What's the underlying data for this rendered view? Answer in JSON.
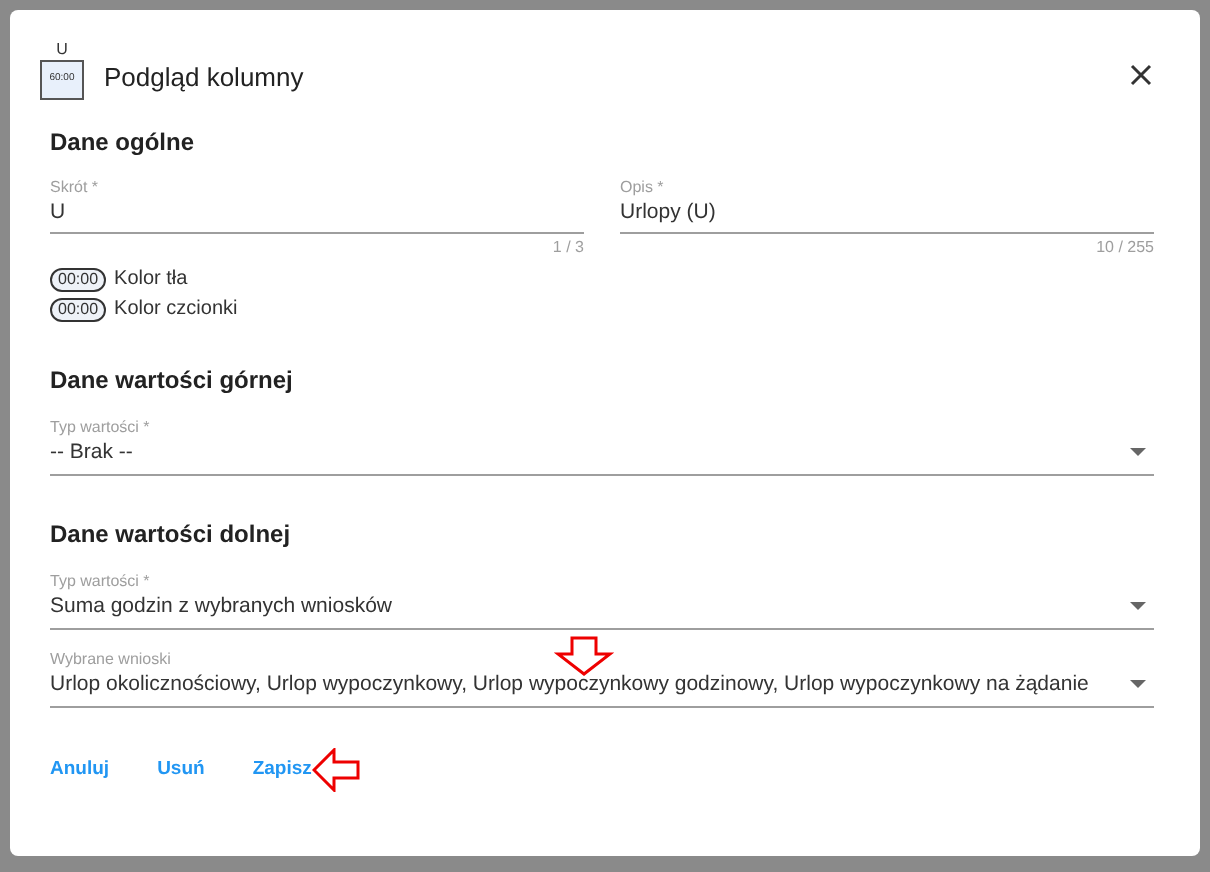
{
  "dialog": {
    "icon": {
      "letter": "U",
      "time": "60:00"
    },
    "title": "Podgląd kolumny"
  },
  "general": {
    "heading": "Dane ogólne",
    "fields": [
      {
        "label": "Skrót *",
        "value": "U",
        "counter": "1 / 3"
      },
      {
        "label": "Opis *",
        "value": "Urlopy (U)",
        "counter": "10 / 255"
      }
    ],
    "colors": [
      {
        "chip": "00:00",
        "label": "Kolor tła"
      },
      {
        "chip": "00:00",
        "label": "Kolor czcionki"
      }
    ]
  },
  "upper": {
    "heading": "Dane wartości górnej",
    "selects": [
      {
        "label": "Typ wartości *",
        "value": "-- Brak --",
        "annotated": false
      }
    ]
  },
  "lower": {
    "heading": "Dane wartości dolnej",
    "selects": [
      {
        "label": "Typ wartości *",
        "value": "Suma godzin z wybranych wniosków",
        "annotated": false
      },
      {
        "label": "Wybrane wnioski",
        "value": "Urlop okolicznościowy, Urlop wypoczynkowy, Urlop wypoczynkowy godzinowy, Urlop wypoczynkowy na żądanie",
        "annotated": true
      }
    ]
  },
  "buttons": [
    {
      "label": "Anuluj",
      "annotated": false
    },
    {
      "label": "Usuń",
      "annotated": false
    },
    {
      "label": "Zapisz",
      "annotated": true
    }
  ]
}
